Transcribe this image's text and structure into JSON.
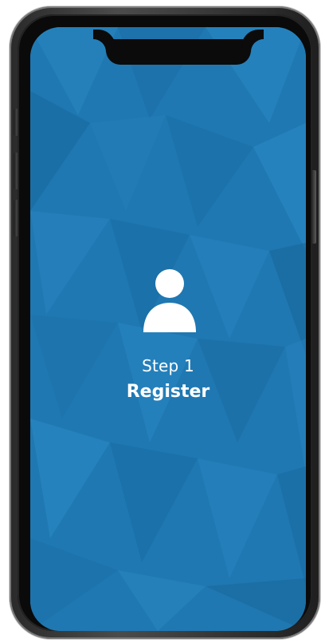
{
  "screen": {
    "step_text": "Step 1",
    "title": "Register"
  },
  "icons": {
    "user": "user-icon"
  },
  "colors": {
    "background": "#1f78b2",
    "text": "#ffffff",
    "device_frame": "#3b3b3b"
  }
}
